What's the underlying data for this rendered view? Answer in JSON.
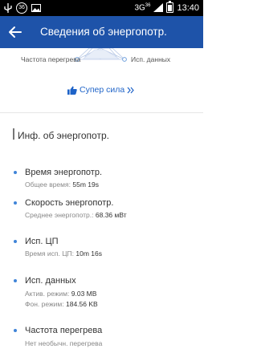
{
  "status_bar": {
    "badge": "36",
    "network": "3G",
    "network_sup": "36",
    "time": "13:40"
  },
  "header": {
    "title": "Сведения об энергопотр."
  },
  "radar": {
    "left_label": "Частота перегрева",
    "right_label": "Исп. данных"
  },
  "super_button": {
    "label": "Супер сила"
  },
  "section": {
    "title": "Инф. об энергопотр."
  },
  "items": [
    {
      "title": "Время энергопотр.",
      "lines": [
        {
          "label": "Общее время:",
          "value": "55m 19s"
        }
      ]
    },
    {
      "title": "Скорость энергопотр.",
      "lines": [
        {
          "label": "Среднее энергопотр.:",
          "value": "68.36 мВт"
        }
      ]
    },
    {
      "title": "Исп. ЦП",
      "lines": [
        {
          "label": "Время исп. ЦП:",
          "value": "10m 16s"
        }
      ]
    },
    {
      "title": "Исп. данных",
      "lines": [
        {
          "label": "Актив. режим:",
          "value": "9.03 MB"
        },
        {
          "label": "Фон. режим:",
          "value": "184.56 KB"
        }
      ]
    },
    {
      "title": "Частота перегрева",
      "lines": [
        {
          "label": "Нет необычн. перегрева",
          "value": ""
        }
      ]
    }
  ]
}
